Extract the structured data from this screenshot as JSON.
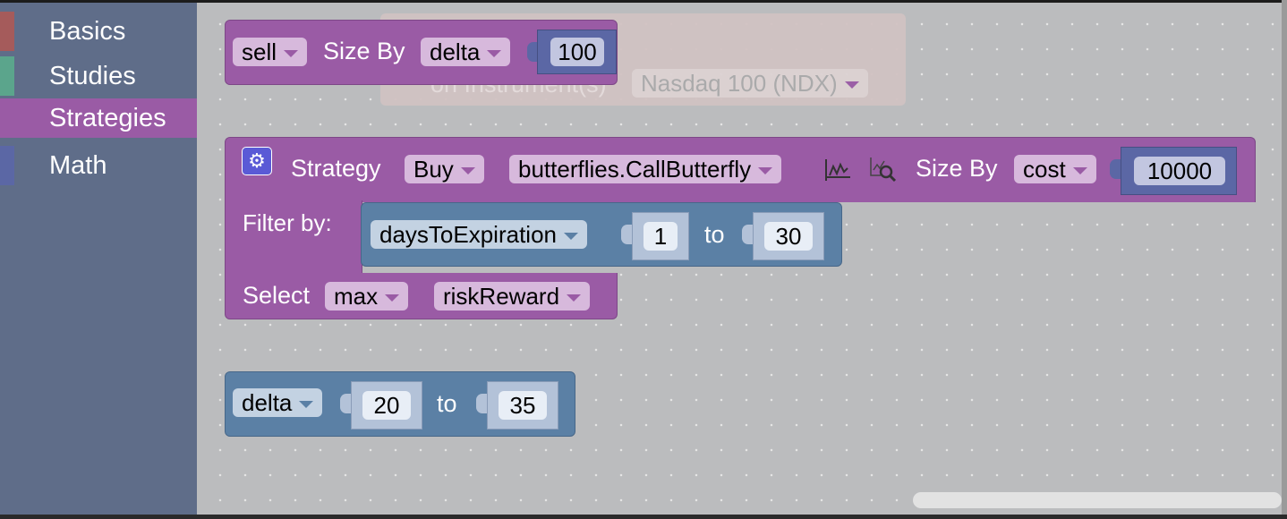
{
  "sidebar": {
    "items": [
      {
        "label": "Basics",
        "color": "#a55b5b"
      },
      {
        "label": "Studies",
        "color": "#5ba58c"
      },
      {
        "label": "Strategies",
        "color": "#9a5ba5",
        "selected": true
      },
      {
        "label": "Math",
        "color": "#5b67a5"
      }
    ]
  },
  "faded_block": {
    "label": "on Instrument(s)",
    "instrument": "Nasdaq 100 (NDX)"
  },
  "sell_block": {
    "action": "sell",
    "size_by_label": "Size By",
    "size_by": "delta",
    "size_value": "100"
  },
  "strategy_block": {
    "title": "Strategy",
    "action": "Buy",
    "strategy": "butterflies.CallButterfly",
    "icons": [
      "chart-icon",
      "chart-search-icon",
      "gear-icon"
    ],
    "size_by_label": "Size By",
    "size_by": "cost",
    "size_value": "10000",
    "filter_label": "Filter by:",
    "filter": {
      "field": "daysToExpiration",
      "from": "1",
      "to_label": "to",
      "to": "30"
    },
    "select_label": "Select",
    "select_mode": "max",
    "select_field": "riskReward"
  },
  "delta_block": {
    "field": "delta",
    "from": "20",
    "to_label": "to",
    "to": "35"
  },
  "colors": {
    "strategies": "#9a5ba5",
    "filter": "#5b80a5",
    "number": "#5b67a5"
  }
}
